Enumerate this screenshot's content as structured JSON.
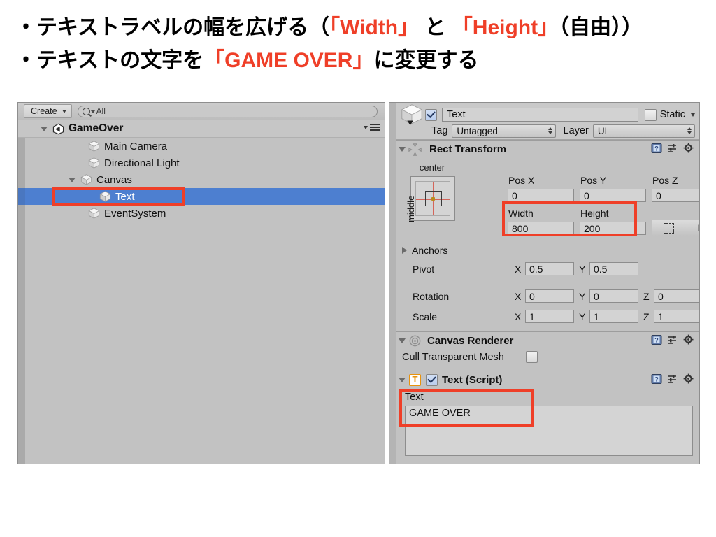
{
  "slide": {
    "bullets": [
      {
        "prefix": "・テキストラベルの幅を広げる（",
        "kw1": "「Width」",
        "mid": " と ",
        "kw2": "「Height」",
        "suffix": "（自由））"
      },
      {
        "prefix": "・テキストの文字を",
        "kw1": "「GAME OVER」",
        "suffix": "に変更する"
      }
    ],
    "accent_color": "#ef3f28"
  },
  "hierarchy": {
    "create_button": "Create",
    "search_placeholder": "All",
    "search_value": "All",
    "scene_name": "GameOver",
    "items": [
      {
        "label": "Main Camera",
        "depth": 2,
        "expandable": false,
        "selected": false
      },
      {
        "label": "Directional Light",
        "depth": 2,
        "expandable": false,
        "selected": false
      },
      {
        "label": "Canvas",
        "depth": 2,
        "expandable": true,
        "expanded": true,
        "selected": false
      },
      {
        "label": "Text",
        "depth": 3,
        "expandable": false,
        "selected": true
      },
      {
        "label": "EventSystem",
        "depth": 2,
        "expandable": false,
        "selected": false
      }
    ]
  },
  "inspector": {
    "object": {
      "enabled": true,
      "name": "Text",
      "static_label": "Static",
      "static_checked": false,
      "tag_label": "Tag",
      "tag_value": "Untagged",
      "layer_label": "Layer",
      "layer_value": "UI"
    },
    "rect_transform": {
      "title": "Rect Transform",
      "anchor_horizontal": "center",
      "anchor_vertical": "middle",
      "pos_x_label": "Pos X",
      "pos_y_label": "Pos Y",
      "pos_z_label": "Pos Z",
      "pos_x": "0",
      "pos_y": "0",
      "pos_z": "0",
      "width_label": "Width",
      "height_label": "Height",
      "width": "800",
      "height": "200",
      "raw_edit_label": "R",
      "anchors_label": "Anchors",
      "pivot_label": "Pivot",
      "pivot_x": "0.5",
      "pivot_y": "0.5",
      "rotation_label": "Rotation",
      "rotation_x": "0",
      "rotation_y": "0",
      "rotation_z": "0",
      "scale_label": "Scale",
      "scale_x": "1",
      "scale_y": "1",
      "scale_z": "1",
      "axis_x": "X",
      "axis_y": "Y",
      "axis_z": "Z"
    },
    "canvas_renderer": {
      "title": "Canvas Renderer",
      "cull_label": "Cull Transparent Mesh",
      "cull_checked": false
    },
    "text_script": {
      "title": "Text (Script)",
      "icon_letter": "T",
      "enabled": true,
      "text_label": "Text",
      "text_value": "GAME OVER"
    }
  }
}
